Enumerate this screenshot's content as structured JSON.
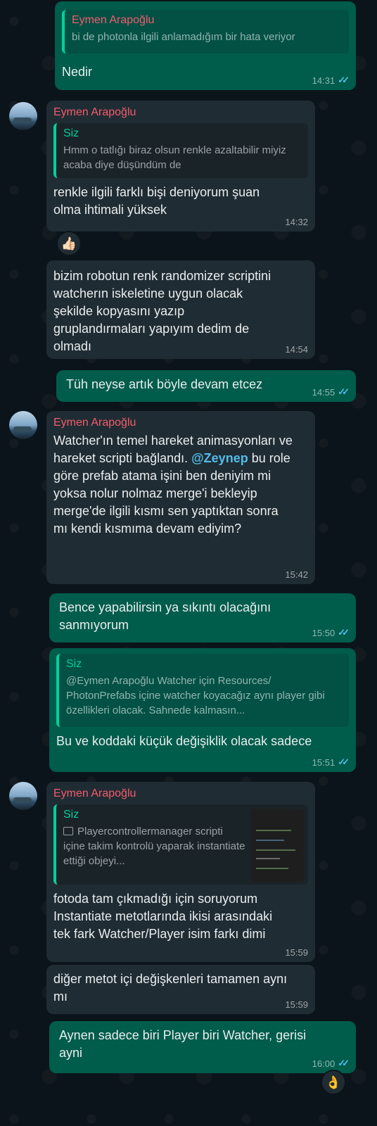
{
  "contact_name": "Eymen Arapoğlu",
  "messages": [
    {
      "quote_name": "Eymen Arapoğlu",
      "quote_text": "bi de photonla ilgili anlamadığım bir hata veriyor",
      "text": "Nedir",
      "time": "14:31"
    },
    {
      "sender": "Eymen Arapoğlu",
      "quote_name": "Siz",
      "quote_text": "Hmm o tatlığı biraz olsun renkle azaltabilir miyiz acaba diye düşündüm de",
      "text": "renkle ilgili farklı bişi deniyorum şuan olma ihtimali yüksek",
      "time": "14:32",
      "reaction": "👍🏻"
    },
    {
      "text": "bizim robotun renk randomizer scriptini watcherın iskeletine uygun olacak şekilde kopyasını yazıp gruplandırmaları yapıyım dedim de olmadı",
      "time": "14:54"
    },
    {
      "text": "Tüh neyse artık böyle devam etcez",
      "time": "14:55"
    },
    {
      "sender": "Eymen Arapoğlu",
      "text_before": "Watcher'ın temel hareket animasyonları ve hareket scripti bağlandı. ",
      "mention": "@Zeynep",
      "text_after": " bu role göre prefab atama işini ben deniyim mi yoksa nolur nolmaz merge'i bekleyip merge'de ilgili kısmı sen yaptıktan sonra mı kendi kısmıma devam ediyim?",
      "time": "15:42"
    },
    {
      "text": "Bence yapabilirsin ya sıkıntı olacağını sanmıyorum",
      "time": "15:50"
    },
    {
      "quote_name": "Siz",
      "quote_text": "@Eymen Arapoğlu Watcher için Resources/ PhotonPrefabs içine watcher koyacağız aynı player gibi özellikleri olacak. Sahnede kalmasın...",
      "text": "Bu ve koddaki küçük değişiklik olacak sadece",
      "time": "15:51"
    },
    {
      "sender": "Eymen Arapoğlu",
      "quote_name": "Siz",
      "quote_text": "Playercontrollermanager scripti içine takim kontrolü yaparak instantiate ettiği objeyi...",
      "text": "fotoda tam çıkmadığı için soruyorum Instantiate metotlarında ikisi arasındaki tek fark Watcher/Player isim farkı dimi",
      "time": "15:59"
    },
    {
      "text": "diğer metot içi değişkenleri tamamen aynı mı",
      "time": "15:59"
    },
    {
      "text": "Aynen sadece biri Player biri Watcher, gerisi ayni",
      "time": "16:00",
      "reaction": "👌"
    }
  ],
  "colors": {
    "background": "#0b141a",
    "outgoing": "#005c4b",
    "incoming": "#202c33",
    "sender_name": "#f15c6d",
    "quote_bar": "#06cf9c",
    "read_ticks": "#53bdeb"
  }
}
